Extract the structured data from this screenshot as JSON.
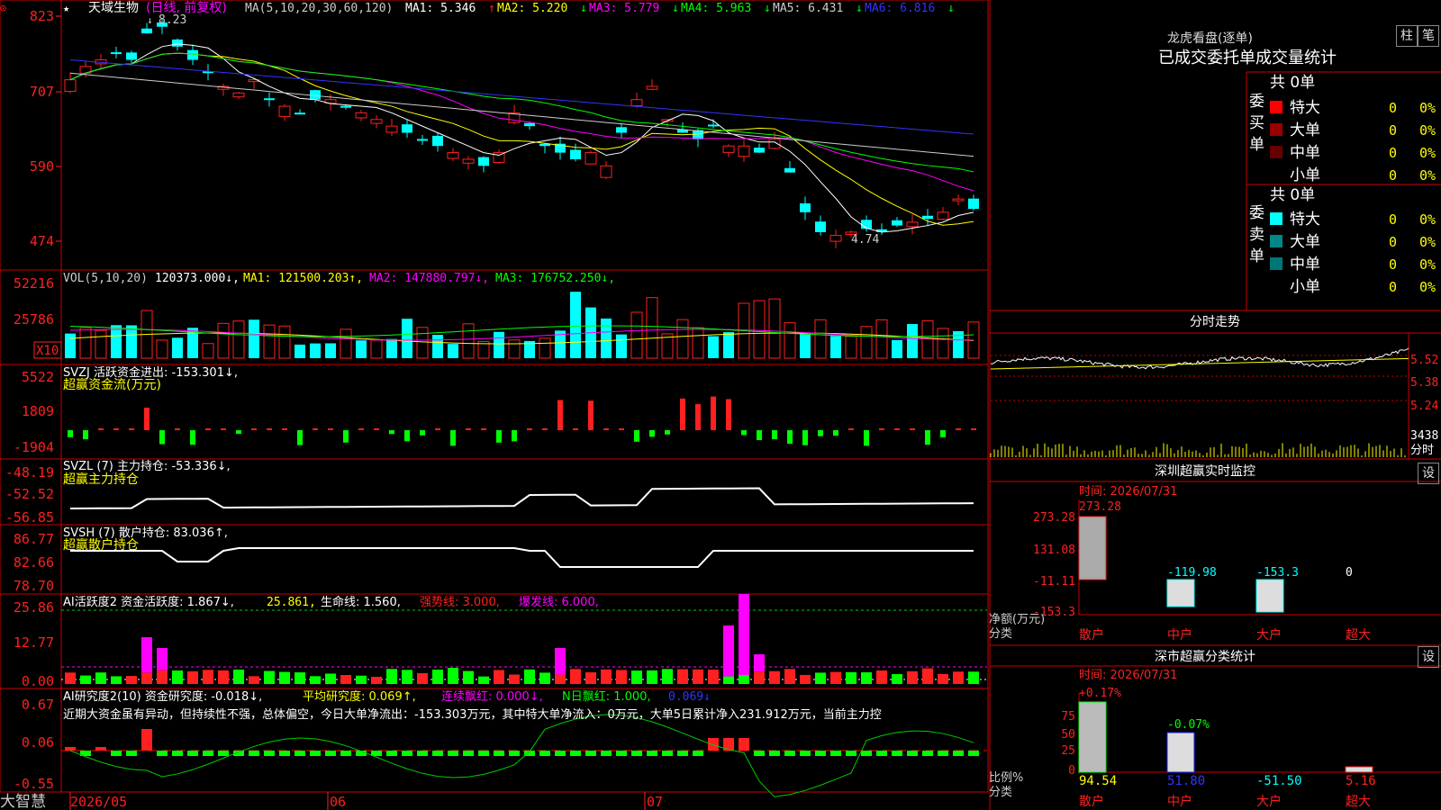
{
  "app_logo": "大智慧",
  "date_axis": [
    "2026/05",
    "06",
    "07"
  ],
  "main": {
    "title": "天域生物",
    "period": "(日线, 前复权)",
    "ma_label": "MA(5,10,20,30,60,120)",
    "ma_values": [
      {
        "name": "MA1:",
        "value": "5.346",
        "arrow": "↑",
        "color": "#ffffff"
      },
      {
        "name": "MA2:",
        "value": "5.220",
        "arrow": "↓",
        "color": "#ffff00"
      },
      {
        "name": "MA3:",
        "value": "5.779",
        "arrow": "↓",
        "color": "#ff00ff"
      },
      {
        "name": "MA4:",
        "value": "5.963",
        "arrow": "↓",
        "color": "#00ff00"
      },
      {
        "name": "MA5:",
        "value": "6.431",
        "arrow": "↓",
        "color": "#cccccc"
      },
      {
        "name": "MA6:",
        "value": "6.816",
        "arrow": "↓",
        "color": "#3333ff"
      }
    ],
    "y_ticks": [
      "823",
      "707",
      "590",
      "474"
    ],
    "high_label": "8.23",
    "low_label": "4.74"
  },
  "vol": {
    "label": "VOL(5,10,20)",
    "value": "120373.000",
    "ma": [
      {
        "name": "MA1:",
        "value": "121500.203",
        "arrow": "↑",
        "color": "#ffff00"
      },
      {
        "name": "MA2:",
        "value": "147880.797",
        "arrow": "↓",
        "color": "#ff00ff"
      },
      {
        "name": "MA3:",
        "value": "176752.250",
        "arrow": "↓",
        "color": "#00ff00"
      }
    ],
    "y_ticks": [
      "52216",
      "25786"
    ],
    "unit": "X10"
  },
  "svzj": {
    "label": "SVZJ",
    "desc": "活跃资金进出:",
    "value": "-153.301",
    "arrow": "↓,",
    "sub": "超赢资金流(万元)",
    "y_ticks": [
      "5522",
      "1809",
      "-1904"
    ]
  },
  "svzl": {
    "label": "SVZL (7)",
    "desc": "主力持仓:",
    "value": "-53.336",
    "arrow": "↓,",
    "sub": "超赢主力持仓",
    "y_ticks": [
      "-48.19",
      "-52.52",
      "-56.85"
    ]
  },
  "svsh": {
    "label": "SVSH (7)",
    "desc": "散户持仓:",
    "value": "83.036",
    "arrow": "↑,",
    "sub": "超赢散户持仓",
    "y_ticks": [
      "86.77",
      "82.66",
      "78.70"
    ]
  },
  "ai_active": {
    "label": "AI活跃度2",
    "desc": "资金活跃度:",
    "value": "1.867",
    "arrow": "↓,",
    "v2": "25.861",
    "life": "生命线: 1.560,",
    "strong": "强势线: 3.000,",
    "burst": "爆发线: 6.000,",
    "y_ticks": [
      "25.86",
      "12.77",
      "0.00"
    ]
  },
  "ai_research": {
    "label": "AI研究度2(10)",
    "desc": "资金研究度:",
    "value": "-0.018",
    "arrow": "↓,",
    "avg": "平均研究度: 0.069↑,",
    "red": "连续飘红: 0.000↓,",
    "nred": "N日飘红: 1.000,",
    "extra": "0.069↓",
    "comment": "近期大资金虽有异动，但持续性不强，总体偏空，今日大单净流出：-153.303万元，其中特大单净流入：0万元，大单5日累计净入231.912万元，当前主力控",
    "y_ticks": [
      "0.67",
      "0.06",
      "-0.55"
    ]
  },
  "lhb": {
    "title": "龙虎看盘(逐单)",
    "btn1": "柱",
    "btn2": "笔",
    "tabs": "已成交委托单成交量统计",
    "buy_side": "委买单",
    "sell_side": "委卖单",
    "buy_total": "共 0单",
    "sell_total": "共 0单",
    "buy_rows": [
      {
        "label": "特大",
        "count": "0",
        "pct": "0%",
        "color": "#ff0000"
      },
      {
        "label": "大单",
        "count": "0",
        "pct": "0%",
        "color": "#990000"
      },
      {
        "label": "中单",
        "count": "0",
        "pct": "0%",
        "color": "#660000"
      },
      {
        "label": "小单",
        "count": "0",
        "pct": "0%",
        "color": "#000000"
      }
    ],
    "sell_rows": [
      {
        "label": "特大",
        "count": "0",
        "pct": "0%",
        "color": "#00ffff"
      },
      {
        "label": "大单",
        "count": "0",
        "pct": "0%",
        "color": "#008888"
      },
      {
        "label": "中单",
        "count": "0",
        "pct": "0%",
        "color": "#007777"
      },
      {
        "label": "小单",
        "count": "0",
        "pct": "0%",
        "color": "#000000"
      }
    ]
  },
  "intraday": {
    "title": "分时走势",
    "y_ticks": [
      "5.52",
      "5.38",
      "5.24"
    ],
    "vol_tick": "3438",
    "vol_unit": "分时"
  },
  "monitor": {
    "title": "深圳超赢实时监控",
    "btn": "设",
    "time": "时间: 2026/07/31",
    "y_ticks": [
      "273.28",
      "131.08",
      "-11.11",
      "-153.3"
    ],
    "ylabel1": "净额(万元)",
    "ylabel2": "分类",
    "categories": [
      "散户",
      "中户",
      "大户",
      "超大"
    ],
    "values": [
      "273.28",
      "-119.98",
      "-153.3",
      "0"
    ]
  },
  "classify": {
    "title": "深市超赢分类统计",
    "btn": "设",
    "time": "时间: 2026/07/31",
    "y_ticks": [
      "75",
      "50",
      "25",
      "0"
    ],
    "ylabel1": "比例%",
    "ylabel2": "分类",
    "categories": [
      "散户",
      "中户",
      "大户",
      "超大"
    ],
    "top_values": [
      "+0.17%",
      "-0.07%",
      "",
      ""
    ],
    "bottom_values": [
      "94.54",
      "51.80",
      "-51.50",
      "5.16"
    ]
  }
}
